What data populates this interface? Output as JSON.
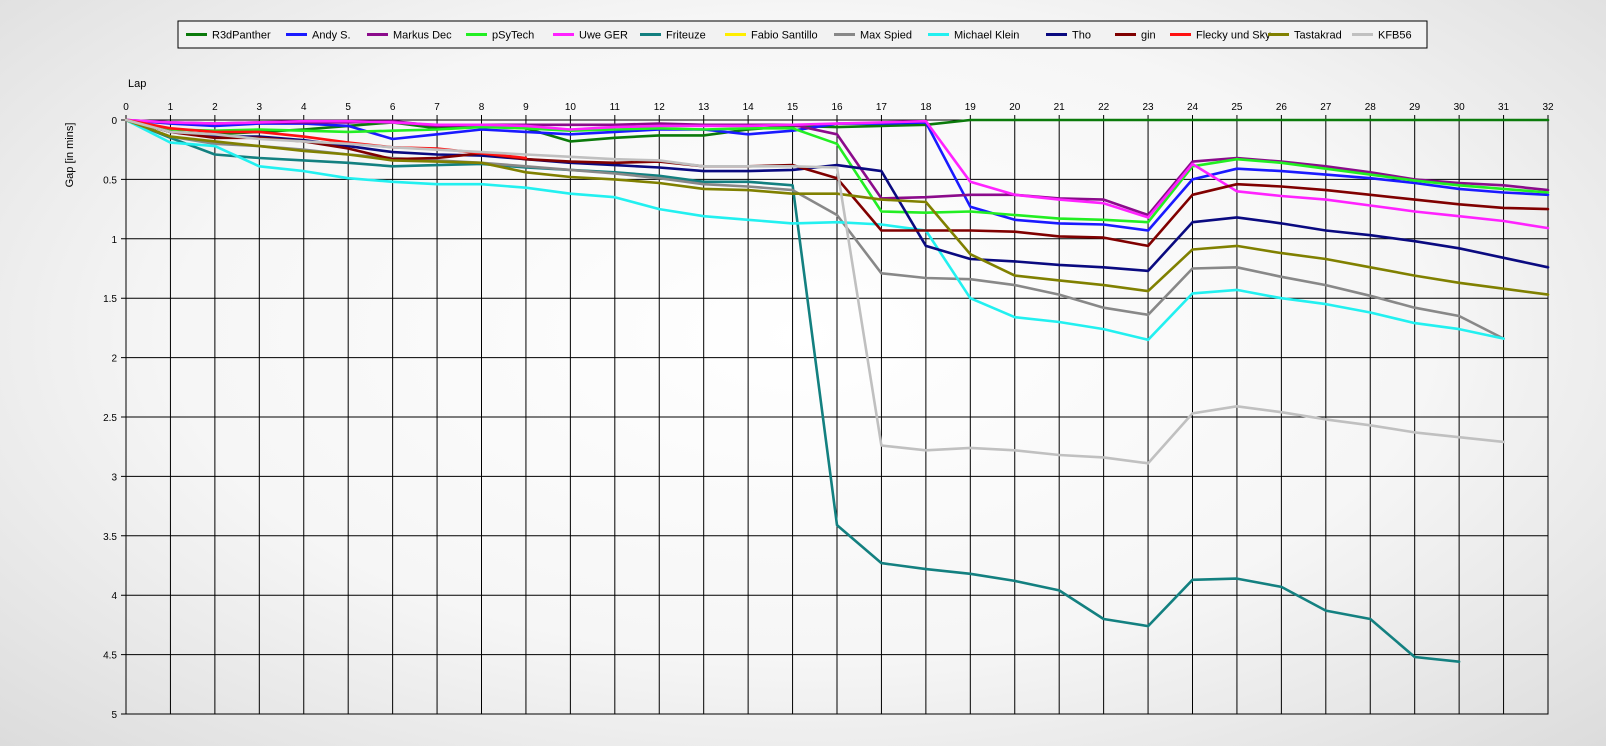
{
  "chart_data": {
    "type": "line",
    "title": "",
    "xlabel": "Lap",
    "ylabel": "Gap [in mins]",
    "xlim": [
      0,
      32
    ],
    "ylim": [
      0,
      5
    ],
    "y_inverted": true,
    "x_ticks": [
      0,
      1,
      2,
      3,
      4,
      5,
      6,
      7,
      8,
      9,
      10,
      11,
      12,
      13,
      14,
      15,
      16,
      17,
      18,
      19,
      20,
      21,
      22,
      23,
      24,
      25,
      26,
      27,
      28,
      29,
      30,
      31,
      32
    ],
    "y_ticks": [
      0,
      0.5,
      1,
      1.5,
      2,
      2.5,
      3,
      3.5,
      4,
      4.5,
      5
    ],
    "x_axis_position": "top",
    "grid": true,
    "legend_position": "top",
    "series": [
      {
        "name": "R3dPanther",
        "color": "#0b7a0b",
        "x": [
          0,
          1,
          2,
          3,
          4,
          5,
          6,
          7,
          8,
          9,
          10,
          11,
          12,
          13,
          14,
          15,
          16,
          17,
          18,
          19,
          20,
          21,
          22,
          23,
          24,
          25,
          26,
          27,
          28,
          29,
          30,
          31,
          32
        ],
        "y": [
          0,
          0.1,
          0.12,
          0.1,
          0.08,
          0.05,
          0.02,
          0.07,
          0.05,
          0.07,
          0.18,
          0.15,
          0.13,
          0.13,
          0.08,
          0.05,
          0.06,
          0.05,
          0.04,
          0,
          0,
          0,
          0,
          0,
          0,
          0,
          0,
          0,
          0,
          0,
          0,
          0,
          0
        ]
      },
      {
        "name": "Andy S.",
        "color": "#1a1aff",
        "x": [
          0,
          1,
          2,
          3,
          4,
          5,
          6,
          7,
          8,
          9,
          10,
          11,
          12,
          13,
          14,
          15,
          16,
          17,
          18,
          19,
          20,
          21,
          22,
          23,
          24,
          25,
          26,
          27,
          28,
          29,
          30,
          31,
          32
        ],
        "y": [
          0,
          0.03,
          0.05,
          0.03,
          0.03,
          0.05,
          0.16,
          0.12,
          0.08,
          0.1,
          0.12,
          0.1,
          0.08,
          0.08,
          0.12,
          0.09,
          0.03,
          0.03,
          0.02,
          0.73,
          0.84,
          0.87,
          0.88,
          0.93,
          0.5,
          0.41,
          0.43,
          0.46,
          0.49,
          0.53,
          0.58,
          0.61,
          0.63
        ]
      },
      {
        "name": "Markus Dec",
        "color": "#8b0b8b",
        "x": [
          0,
          1,
          2,
          3,
          4,
          5,
          6,
          7,
          8,
          9,
          10,
          11,
          12,
          13,
          14,
          15,
          16,
          17,
          18,
          19,
          20,
          21,
          22,
          23,
          24,
          25,
          26,
          27,
          28,
          29,
          30,
          31,
          32
        ],
        "y": [
          0,
          0.02,
          0.03,
          0.02,
          0.02,
          0.02,
          0.01,
          0.05,
          0.04,
          0.04,
          0.04,
          0.04,
          0.03,
          0.04,
          0.04,
          0.04,
          0.12,
          0.66,
          0.65,
          0.63,
          0.63,
          0.66,
          0.67,
          0.8,
          0.35,
          0.32,
          0.35,
          0.39,
          0.44,
          0.5,
          0.53,
          0.55,
          0.59
        ]
      },
      {
        "name": "pSyTech",
        "color": "#22ee22",
        "x": [
          0,
          1,
          2,
          3,
          4,
          5,
          6,
          7,
          8,
          9,
          10,
          11,
          12,
          13,
          14,
          15,
          16,
          17,
          18,
          19,
          20,
          21,
          22,
          23,
          24,
          25,
          26,
          27,
          28,
          29,
          30,
          31,
          32
        ],
        "y": [
          0,
          0.08,
          0.09,
          0.08,
          0.09,
          0.1,
          0.09,
          0.08,
          0.06,
          0.07,
          0.09,
          0.08,
          0.07,
          0.08,
          0.07,
          0.07,
          0.2,
          0.77,
          0.78,
          0.77,
          0.8,
          0.83,
          0.84,
          0.86,
          0.39,
          0.33,
          0.36,
          0.41,
          0.46,
          0.51,
          0.55,
          0.58,
          0.61
        ]
      },
      {
        "name": "Uwe GER",
        "color": "#ff22ff",
        "x": [
          0,
          1,
          2,
          3,
          4,
          5,
          6,
          7,
          8,
          9,
          10,
          11,
          12,
          13,
          14,
          15,
          16,
          17,
          18,
          19,
          20,
          21,
          22,
          23,
          24,
          25,
          26,
          27,
          28,
          29,
          30,
          31,
          32
        ],
        "y": [
          0,
          0.02,
          0.03,
          0.02,
          0.01,
          0.01,
          0.02,
          0.04,
          0.04,
          0.05,
          0.08,
          0.06,
          0.05,
          0.05,
          0.05,
          0.04,
          0.03,
          0.02,
          0.01,
          0.52,
          0.63,
          0.67,
          0.7,
          0.82,
          0.37,
          0.6,
          0.64,
          0.67,
          0.72,
          0.77,
          0.81,
          0.85,
          0.91
        ]
      },
      {
        "name": "Friteuze",
        "color": "#138080",
        "x": [
          0,
          1,
          2,
          3,
          4,
          5,
          6,
          7,
          8,
          9,
          10,
          11,
          12,
          13,
          14,
          15,
          16,
          17,
          18,
          19,
          20,
          21,
          22,
          23,
          24,
          25,
          26,
          27,
          28,
          29,
          30
        ],
        "y": [
          0,
          0.15,
          0.29,
          0.32,
          0.34,
          0.36,
          0.39,
          0.38,
          0.37,
          0.4,
          0.42,
          0.44,
          0.47,
          0.52,
          0.52,
          0.55,
          3.41,
          3.73,
          3.78,
          3.82,
          3.88,
          3.96,
          4.2,
          4.26,
          3.87,
          3.86,
          3.93,
          4.13,
          4.2,
          4.52,
          4.56
        ]
      },
      {
        "name": "Fabio Santillo",
        "color": "#ffee00",
        "x": [],
        "y": []
      },
      {
        "name": "Max Spied",
        "color": "#888888",
        "x": [
          0,
          1,
          2,
          3,
          4,
          5,
          6,
          7,
          8,
          9,
          10,
          11,
          12,
          13,
          14,
          15,
          16,
          17,
          18,
          19,
          20,
          21,
          22,
          23,
          24,
          25,
          26,
          27,
          28,
          29,
          30,
          31
        ],
        "y": [
          0,
          0.14,
          0.2,
          0.22,
          0.25,
          0.29,
          0.32,
          0.34,
          0.36,
          0.39,
          0.42,
          0.45,
          0.49,
          0.54,
          0.56,
          0.59,
          0.8,
          1.29,
          1.33,
          1.34,
          1.39,
          1.47,
          1.58,
          1.64,
          1.25,
          1.24,
          1.32,
          1.39,
          1.48,
          1.58,
          1.65,
          1.84
        ]
      },
      {
        "name": "Michael Klein",
        "color": "#22f0f0",
        "x": [
          0,
          1,
          2,
          3,
          4,
          5,
          6,
          7,
          8,
          9,
          10,
          11,
          12,
          13,
          14,
          15,
          16,
          17,
          18,
          19,
          20,
          21,
          22,
          23,
          24,
          25,
          26,
          27,
          28,
          29,
          30,
          31
        ],
        "y": [
          0,
          0.19,
          0.22,
          0.39,
          0.43,
          0.49,
          0.52,
          0.54,
          0.54,
          0.57,
          0.62,
          0.65,
          0.75,
          0.81,
          0.84,
          0.87,
          0.86,
          0.88,
          0.93,
          1.5,
          1.66,
          1.7,
          1.76,
          1.85,
          1.46,
          1.43,
          1.5,
          1.55,
          1.62,
          1.71,
          1.76,
          1.84
        ]
      },
      {
        "name": "Tho",
        "color": "#0a0a80",
        "x": [
          0,
          1,
          2,
          3,
          4,
          5,
          6,
          7,
          8,
          9,
          10,
          11,
          12,
          13,
          14,
          15,
          16,
          17,
          18,
          19,
          20,
          21,
          22,
          23,
          24,
          25,
          26,
          27,
          28,
          29,
          30,
          31,
          32
        ],
        "y": [
          0,
          0.1,
          0.14,
          0.14,
          0.17,
          0.22,
          0.27,
          0.29,
          0.3,
          0.33,
          0.36,
          0.38,
          0.4,
          0.43,
          0.43,
          0.42,
          0.38,
          0.43,
          1.06,
          1.17,
          1.19,
          1.22,
          1.24,
          1.27,
          0.86,
          0.82,
          0.87,
          0.93,
          0.97,
          1.02,
          1.08,
          1.16,
          1.24
        ]
      },
      {
        "name": "gin",
        "color": "#800000",
        "x": [
          0,
          1,
          2,
          3,
          4,
          5,
          6,
          7,
          8,
          9,
          10,
          11,
          12,
          13,
          14,
          15,
          16,
          17,
          18,
          19,
          20,
          21,
          22,
          23,
          24,
          25,
          26,
          27,
          28,
          29,
          30,
          31,
          32
        ],
        "y": [
          0,
          0.1,
          0.15,
          0.15,
          0.18,
          0.24,
          0.33,
          0.32,
          0.28,
          0.33,
          0.35,
          0.36,
          0.35,
          0.39,
          0.39,
          0.38,
          0.49,
          0.93,
          0.93,
          0.93,
          0.94,
          0.98,
          0.99,
          1.06,
          0.63,
          0.54,
          0.56,
          0.59,
          0.63,
          0.67,
          0.71,
          0.74,
          0.75
        ]
      },
      {
        "name": "Flecky und Sky",
        "color": "#ff1111",
        "x": [
          0,
          1,
          2,
          3,
          4,
          5,
          6,
          7,
          8,
          9
        ],
        "y": [
          0,
          0.07,
          0.1,
          0.1,
          0.14,
          0.19,
          0.23,
          0.24,
          0.28,
          0.32
        ]
      },
      {
        "name": "Tastakrad",
        "color": "#808000",
        "x": [
          0,
          1,
          2,
          3,
          4,
          5,
          6,
          7,
          8,
          9,
          10,
          11,
          12,
          13,
          14,
          15,
          16,
          17,
          18,
          19,
          20,
          21,
          22,
          23,
          24,
          25,
          26,
          27,
          28,
          29,
          30,
          31,
          32
        ],
        "y": [
          0,
          0.14,
          0.18,
          0.22,
          0.26,
          0.29,
          0.34,
          0.35,
          0.36,
          0.44,
          0.48,
          0.5,
          0.53,
          0.58,
          0.59,
          0.62,
          0.62,
          0.67,
          0.69,
          1.13,
          1.31,
          1.35,
          1.39,
          1.44,
          1.09,
          1.06,
          1.12,
          1.17,
          1.24,
          1.31,
          1.37,
          1.42,
          1.47
        ]
      },
      {
        "name": "KFB56",
        "color": "#c0c0c0",
        "x": [
          0,
          1,
          2,
          3,
          4,
          5,
          6,
          7,
          8,
          9,
          10,
          11,
          12,
          13,
          14,
          15,
          16,
          17,
          18,
          19,
          20,
          21,
          22,
          23,
          24,
          25,
          26,
          27,
          28,
          29,
          30,
          31
        ],
        "y": [
          0,
          0.1,
          0.12,
          0.16,
          0.18,
          0.2,
          0.23,
          0.25,
          0.27,
          0.29,
          0.31,
          0.33,
          0.34,
          0.39,
          0.39,
          0.39,
          0.4,
          2.74,
          2.78,
          2.76,
          2.78,
          2.82,
          2.84,
          2.89,
          2.47,
          2.41,
          2.46,
          2.52,
          2.57,
          2.63,
          2.67,
          2.71
        ]
      }
    ]
  }
}
